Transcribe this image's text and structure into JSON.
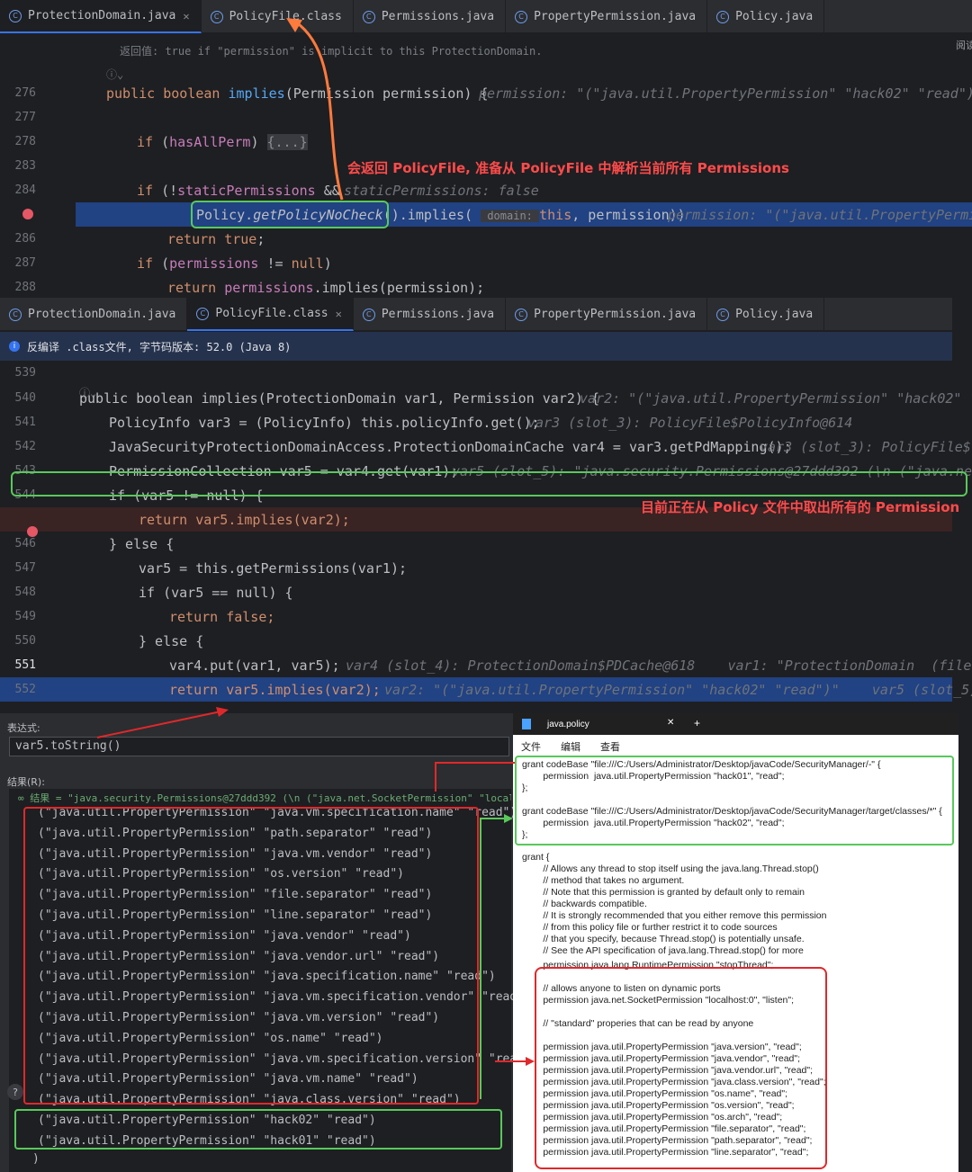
{
  "top": {
    "tabs": [
      "ProtectionDomain.java",
      "PolicyFile.class",
      "Permissions.java",
      "PropertyPermission.java",
      "Policy.java"
    ],
    "doc_hint": "返回值: true if \"permission\" is implicit to this ProtectionDomain.",
    "reader_label": "阅读",
    "annotation": "会返回 PolicyFile, 准备从 PolicyFile 中解析当前所有 Permissions",
    "lines": [
      {
        "n": "276",
        "code": "public boolean implies(Permission permission) {",
        "hint": "permission: \"(\"java.util.PropertyPermission\" \"hack02\" \"read\")\""
      },
      {
        "n": "277",
        "code": "",
        "hint": ""
      },
      {
        "n": "278",
        "code": "if (hasAllPerm) {...}",
        "hint": ""
      },
      {
        "n": "283",
        "code": "",
        "hint": ""
      },
      {
        "n": "284",
        "code": "if (!staticPermissions &&",
        "hint": "staticPermissions: false"
      },
      {
        "n": "",
        "code": "Policy.getPolicyNoCheck().implies( domain: this, permission))",
        "hint": "permission: \"(\"java.util.PropertyPermiss"
      },
      {
        "n": "286",
        "code": "return true;",
        "hint": ""
      },
      {
        "n": "287",
        "code": "if (permissions != null)",
        "hint": ""
      },
      {
        "n": "288",
        "code": "return permissions.implies(permission);",
        "hint": ""
      }
    ]
  },
  "bottom": {
    "tabs": [
      "ProtectionDomain.java",
      "PolicyFile.class",
      "Permissions.java",
      "PropertyPermission.java",
      "Policy.java"
    ],
    "decompile_notice": "反编译 .class文件, 字节码版本: 52.0 (Java 8)",
    "annotation": "目前正在从 Policy 文件中取出所有的 Permission",
    "lines": [
      {
        "n": "539",
        "code": "",
        "hint": ""
      },
      {
        "n": "540",
        "code": "public boolean implies(ProtectionDomain var1, Permission var2) {",
        "hint": "var2: \"(\"java.util.PropertyPermission\" \"hack02\" \"r"
      },
      {
        "n": "541",
        "code": "PolicyInfo var3 = (PolicyInfo) this.policyInfo.get();",
        "hint": "var3 (slot_3): PolicyFile$PolicyInfo@614"
      },
      {
        "n": "542",
        "code": "JavaSecurityProtectionDomainAccess.ProtectionDomainCache var4 = var3.getPdMapping();",
        "hint": "var3 (slot_3): PolicyFile$"
      },
      {
        "n": "543",
        "code": "PermissionCollection var5 = var4.get(var1);",
        "hint": "var5 (slot_5): \"java.security.Permissions@27ddd392 (\\n (\"java.net.S"
      },
      {
        "n": "544",
        "code": "if (var5 != null) {",
        "hint": ""
      },
      {
        "n": "",
        "code": "return var5.implies(var2);",
        "hint": ""
      },
      {
        "n": "546",
        "code": "} else {",
        "hint": ""
      },
      {
        "n": "547",
        "code": "var5 = this.getPermissions(var1);",
        "hint": ""
      },
      {
        "n": "548",
        "code": "if (var5 == null) {",
        "hint": ""
      },
      {
        "n": "549",
        "code": "return false;",
        "hint": ""
      },
      {
        "n": "550",
        "code": "} else {",
        "hint": ""
      },
      {
        "n": "551",
        "code": "var4.put(var1, var5);",
        "hint": "var4 (slot_4): ProtectionDomain$PDCache@618    var1: \"ProtectionDomain  (file:/C:"
      },
      {
        "n": "552",
        "code": "return var5.implies(var2);",
        "hint": "var2: \"(\"java.util.PropertyPermission\" \"hack02\" \"read\")\"    var5 (slot_5): \""
      }
    ]
  },
  "eval": {
    "expr_label": "表达式:",
    "expr_value": "var5.toString()",
    "result_label": "结果(R):",
    "result_header": "∞ 结果 = \"java.security.Permissions@27ddd392 (\\n (\"java.net.SocketPermission\" \"localhost:0\"",
    "rows": [
      "(\"java.util.PropertyPermission\" \"java.vm.specification.name\" \"read\")",
      "(\"java.util.PropertyPermission\" \"path.separator\" \"read\")",
      "(\"java.util.PropertyPermission\" \"java.vm.vendor\" \"read\")",
      "(\"java.util.PropertyPermission\" \"os.version\" \"read\")",
      "(\"java.util.PropertyPermission\" \"file.separator\" \"read\")",
      "(\"java.util.PropertyPermission\" \"line.separator\" \"read\")",
      "(\"java.util.PropertyPermission\" \"java.vendor\" \"read\")",
      "(\"java.util.PropertyPermission\" \"java.vendor.url\" \"read\")",
      "(\"java.util.PropertyPermission\" \"java.specification.name\" \"read\")",
      "(\"java.util.PropertyPermission\" \"java.vm.specification.vendor\" \"read\")",
      "(\"java.util.PropertyPermission\" \"java.vm.version\" \"read\")",
      "(\"java.util.PropertyPermission\" \"os.name\" \"read\")",
      "(\"java.util.PropertyPermission\" \"java.vm.specification.version\" \"read\")",
      "(\"java.util.PropertyPermission\" \"java.vm.name\" \"read\")",
      "(\"java.util.PropertyPermission\" \"java.class.version\" \"read\")",
      "(\"java.util.PropertyPermission\" \"hack02\" \"read\")",
      "(\"java.util.PropertyPermission\" \"hack01\" \"read\")",
      ")"
    ]
  },
  "notepad": {
    "title": "java.policy",
    "new_tab": "+",
    "close": "✕",
    "menu": [
      "文件",
      "编辑",
      "查看"
    ],
    "block1": "grant codeBase \"file:///C:/Users/Administrator/Desktop/javaCode/SecurityManager/-\" {\n        permission  java.util.PropertyPermission \"hack01\", \"read\";\n};\n\ngrant codeBase \"file:///C:/Users/Administrator/Desktop/javaCode/SecurityManager/target/classes/*\" {\n        permission  java.util.PropertyPermission \"hack02\", \"read\";\n};",
    "block2": "grant {\n        // Allows any thread to stop itself using the java.lang.Thread.stop()\n        // method that takes no argument.\n        // Note that this permission is granted by default only to remain\n        // backwards compatible.\n        // It is strongly recommended that you either remove this permission\n        // from this policy file or further restrict it to code sources\n        // that you specify, because Thread.stop() is potentially unsafe.\n        // See the API specification of java.lang.Thread.stop() for more\n        // information.",
    "block3": "        permission java.lang.RuntimePermission \"stopThread\";\n\n        // allows anyone to listen on dynamic ports\n        permission java.net.SocketPermission \"localhost:0\", \"listen\";\n\n        // \"standard\" properies that can be read by anyone\n\n        permission java.util.PropertyPermission \"java.version\", \"read\";\n        permission java.util.PropertyPermission \"java.vendor\", \"read\";\n        permission java.util.PropertyPermission \"java.vendor.url\", \"read\";\n        permission java.util.PropertyPermission \"java.class.version\", \"read\";\n        permission java.util.PropertyPermission \"os.name\", \"read\";\n        permission java.util.PropertyPermission \"os.version\", \"read\";\n        permission java.util.PropertyPermission \"os.arch\", \"read\";\n        permission java.util.PropertyPermission \"file.separator\", \"read\";\n        permission java.util.PropertyPermission \"path.separator\", \"read\";\n        permission java.util.PropertyPermission \"line.separator\", \"read\";"
  }
}
